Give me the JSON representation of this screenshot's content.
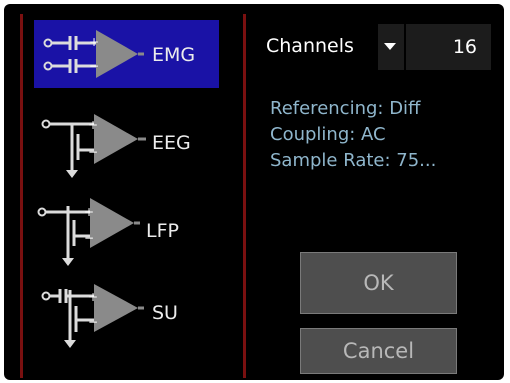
{
  "modes": [
    {
      "id": "emg",
      "label": "EMG",
      "selected": true
    },
    {
      "id": "eeg",
      "label": "EEG",
      "selected": false
    },
    {
      "id": "lfp",
      "label": "LFP",
      "selected": false
    },
    {
      "id": "su",
      "label": "SU",
      "selected": false
    }
  ],
  "channels": {
    "label": "Channels",
    "value": "16"
  },
  "info": {
    "referencing": "Referencing: Diff",
    "coupling": "Coupling: AC",
    "sample_rate": "Sample Rate: 75..."
  },
  "buttons": {
    "ok": "OK",
    "cancel": "Cancel"
  },
  "colors": {
    "selected_bg": "#1a12a6",
    "divider": "#7a1010",
    "info_text": "#8fb6cc",
    "button_bg": "#4e4e4e",
    "amp_gray": "#8a8a8a"
  }
}
